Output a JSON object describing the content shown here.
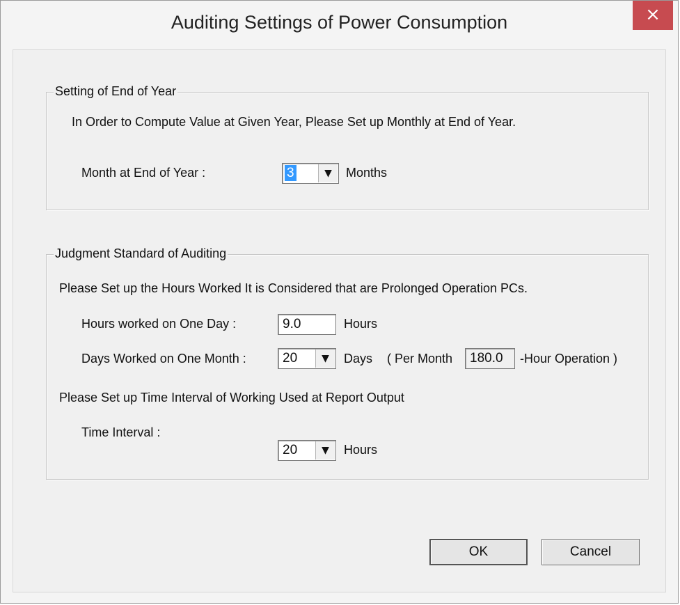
{
  "window": {
    "title": "Auditing Settings of Power Consumption",
    "close_glyph": "×"
  },
  "year_end_group": {
    "legend": "Setting of End of Year",
    "description": "In Order to Compute Value at Given Year, Please Set up Monthly at End of Year.",
    "month_label": "Month at End of Year :",
    "month_value": "3",
    "month_unit": "Months"
  },
  "auditing_group": {
    "legend": "Judgment Standard of Auditing",
    "description": "Please Set up the Hours Worked It is Considered that are Prolonged Operation PCs.",
    "hours_label": "Hours worked on One Day :",
    "hours_value": "9.0",
    "hours_unit": "Hours",
    "days_label": "Days Worked on One Month :",
    "days_value": "20",
    "days_unit": "Days",
    "per_month_prefix": "( Per Month",
    "per_month_value": "180.0",
    "per_month_suffix": "-Hour Operation )",
    "interval_description": "Please Set up Time Interval of Working Used at Report Output",
    "interval_label": "Time Interval :",
    "interval_value": "20",
    "interval_unit": "Hours"
  },
  "buttons": {
    "ok": "OK",
    "cancel": "Cancel"
  },
  "icons": {
    "dropdown": "chevron-down-icon",
    "close": "close-icon"
  },
  "colors": {
    "close_button": "#c74b50",
    "selection": "#3399ff"
  }
}
